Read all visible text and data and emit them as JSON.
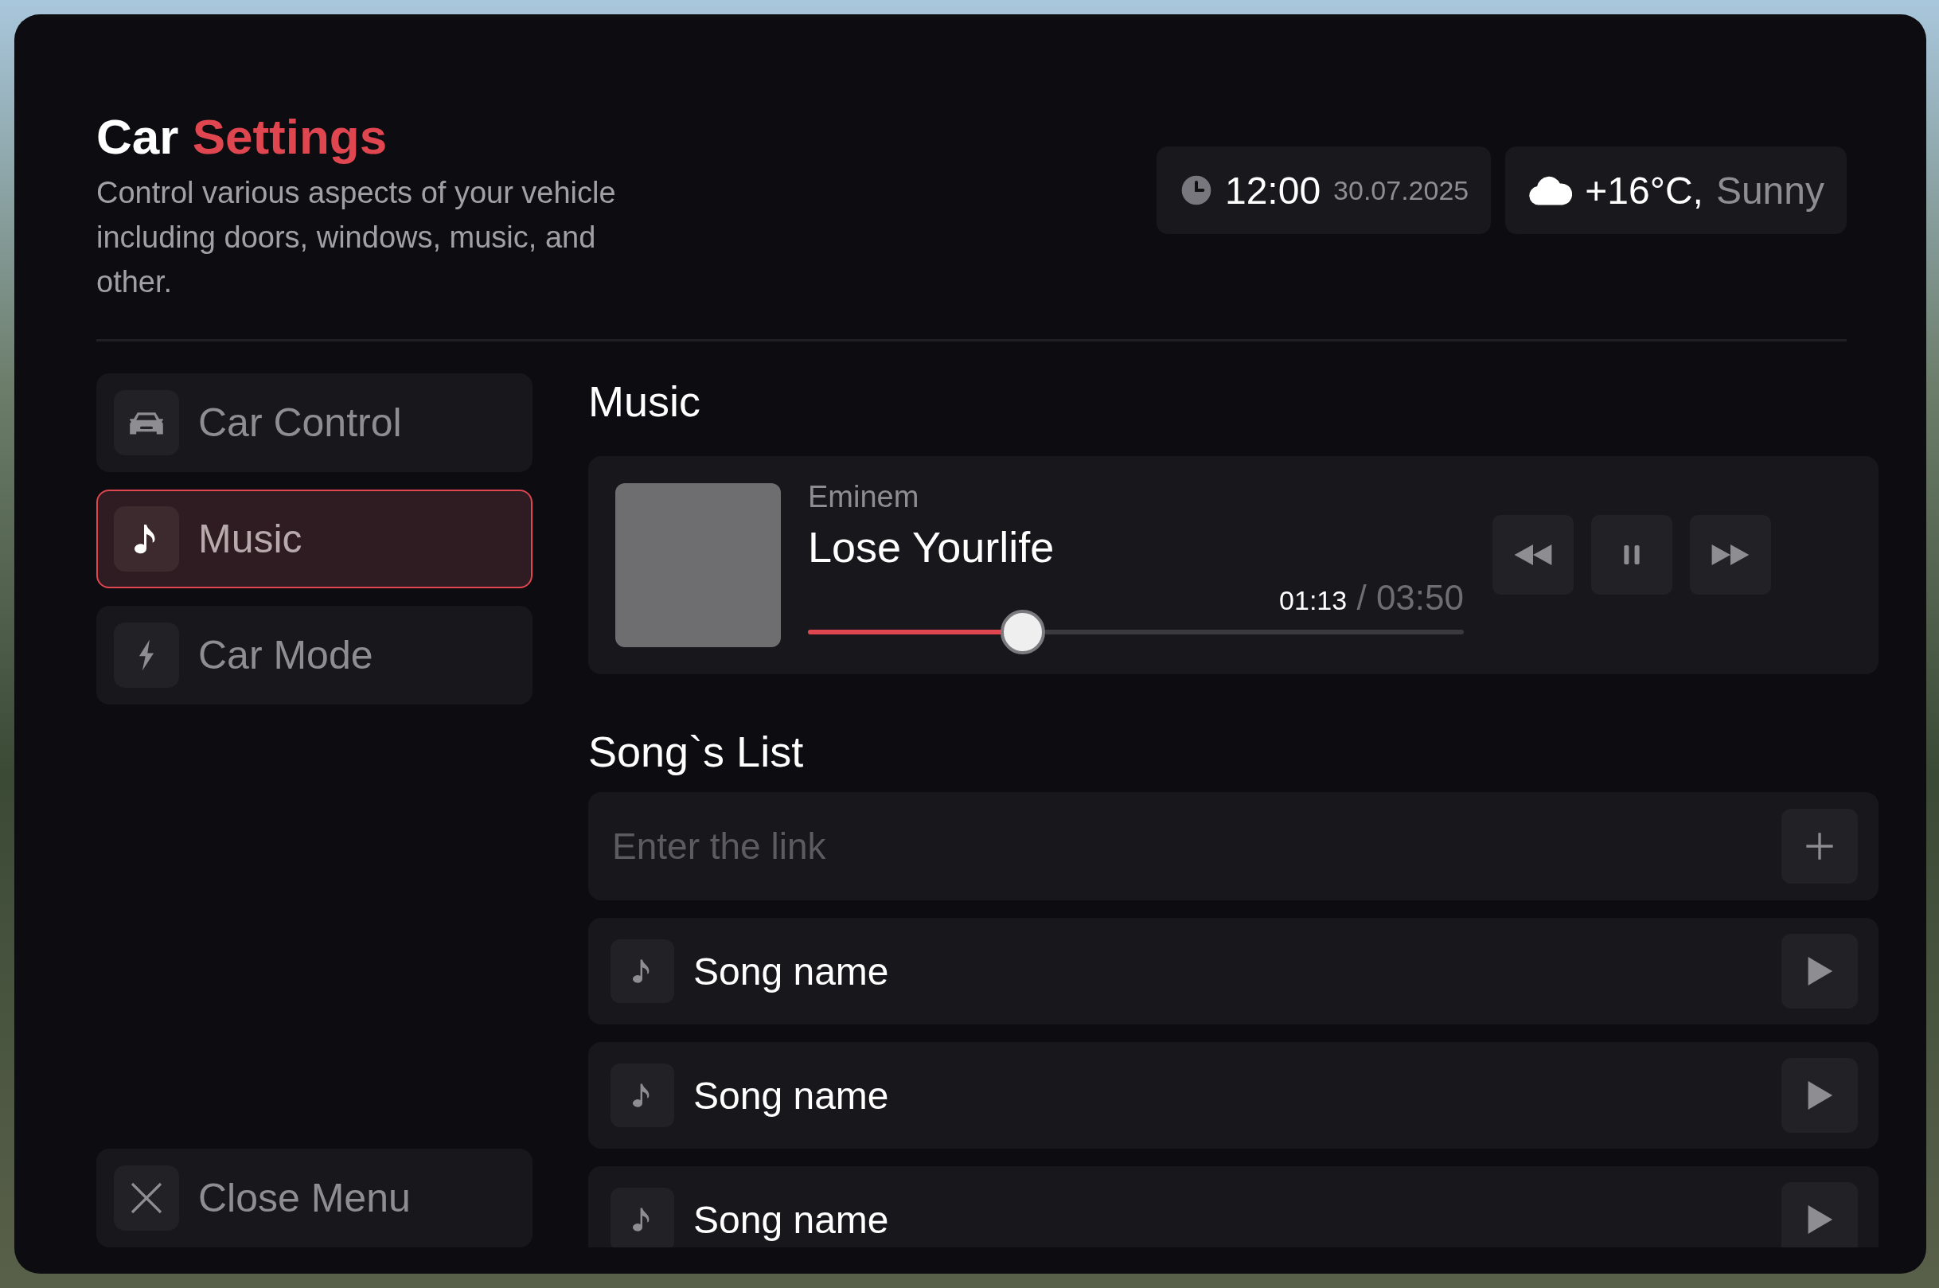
{
  "header": {
    "title": {
      "lead": "Car",
      "accent": "Settings"
    },
    "subtitle": "Control various aspects of your vehicle including doors, windows, music, and other.",
    "time": "12:00",
    "date": "30.07.2025",
    "temperature": "+16°C,",
    "condition": "Sunny"
  },
  "sidebar": {
    "items": [
      {
        "label": "Car Control",
        "selected": false
      },
      {
        "label": "Music",
        "selected": true
      },
      {
        "label": "Car Mode",
        "selected": false
      }
    ],
    "close": {
      "label": "Close Menu"
    }
  },
  "music": {
    "heading": "Music",
    "player": {
      "artist": "Eminem",
      "title": "Lose Yourlife",
      "elapsed": "01:13",
      "separator": "/",
      "duration": "03:50",
      "level": 0.33
    }
  },
  "songs": {
    "heading": "Song`s List",
    "link_field": {
      "placeholder": "Enter the link"
    },
    "items": [
      {
        "name": "Song name"
      },
      {
        "name": "Song name"
      },
      {
        "name": "Song name"
      }
    ]
  }
}
